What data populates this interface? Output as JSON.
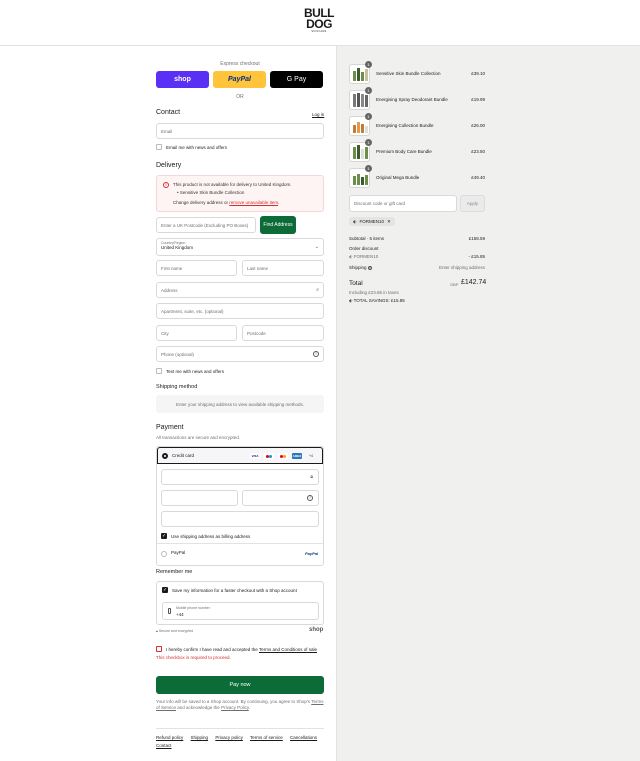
{
  "brand": {
    "line1": "BULL",
    "line2": "DOG",
    "tagline": "SKINCARE"
  },
  "express": {
    "label": "Express checkout",
    "shop": "shop",
    "paypal": "PayPal",
    "gpay": "G Pay",
    "or": "OR"
  },
  "contact": {
    "heading": "Contact",
    "login": "Log in",
    "email_placeholder": "Email",
    "news_label": "Email me with news and offers"
  },
  "delivery": {
    "heading": "Delivery",
    "alert_title": "This product is not available for delivery to United Kingdom.",
    "alert_item": "Sensitive Skin Bundle Collection",
    "alert_text": "Change delivery address or",
    "alert_link": "remove unavailable item",
    "alert_end": ".",
    "postcode_placeholder": "Enter a UK Postcode (Excluding PO Boxes)",
    "find_address": "Find Address",
    "country_label": "Country/Region",
    "country_value": "United Kingdom",
    "first_name": "First name",
    "last_name": "Last name",
    "address": "Address",
    "apartment": "Apartment, suite, etc. (optional)",
    "city": "City",
    "postcode": "Postcode",
    "phone": "Phone (optional)",
    "text_label": "Text me with news and offers"
  },
  "shipping": {
    "heading": "Shipping method",
    "note": "Enter your shipping address to view available shipping methods."
  },
  "payment": {
    "heading": "Payment",
    "sub": "All transactions are secure and encrypted.",
    "credit_card": "Credit card",
    "cards": [
      "VISA",
      "MC",
      "MC",
      "AMEX"
    ],
    "more": "+4",
    "billing_label": "Use shipping address as billing address",
    "paypal": "PayPal",
    "paypal_logo": "PayPal"
  },
  "remember": {
    "heading": "Remember me",
    "save_label": "Save my information for a faster checkout with a Shop account",
    "mobile_label": "Mobile phone number",
    "mobile_value": "+44",
    "secure": "Secure and encrypted",
    "shop": "shop"
  },
  "terms": {
    "text": "I hereby confirm I have read and accepted the",
    "link": "Terms and Conditions of sale",
    "error": "This checkbox is required to proceed."
  },
  "pay_now": "Pay now",
  "disclaimer": {
    "text": "Your info will be saved to a Shop account. By continuing, you agree to Shop's",
    "tos": "Terms of Service",
    "and": "and acknowledge the",
    "privacy": "Privacy Policy",
    "end": "."
  },
  "footer": [
    "Refund policy",
    "Shipping",
    "Privacy policy",
    "Terms of service",
    "Cancellations",
    "Contact"
  ],
  "cart": {
    "items": [
      {
        "name": "Sensitive Skin Bundle Collection",
        "price": "£39.10",
        "qty": "1"
      },
      {
        "name": "Energising Spray Deodorant Bundle",
        "price": "£19.99",
        "qty": "1"
      },
      {
        "name": "Energising Collection Bundle",
        "price": "£26.00",
        "qty": "1"
      },
      {
        "name": "Premium Body Care Bundle",
        "price": "£23.50",
        "qty": "1"
      },
      {
        "name": "Original Mega Bundle",
        "price": "£49.40",
        "qty": "1"
      }
    ],
    "discount_placeholder": "Discount code or gift card",
    "apply": "Apply",
    "code": "FORMEN10",
    "subtotal_label": "Subtotal · 5 items",
    "subtotal": "£158.59",
    "order_discount": "Order discount",
    "discount_code": "FORMEN10",
    "discount_value": "- £15.85",
    "shipping_label": "Shipping",
    "shipping_value": "Enter shipping address",
    "total_label": "Total",
    "currency": "GBP",
    "total": "£142.74",
    "taxes": "Including £23.86 in taxes",
    "savings": "TOTAL SAVINGS: £15.85"
  }
}
